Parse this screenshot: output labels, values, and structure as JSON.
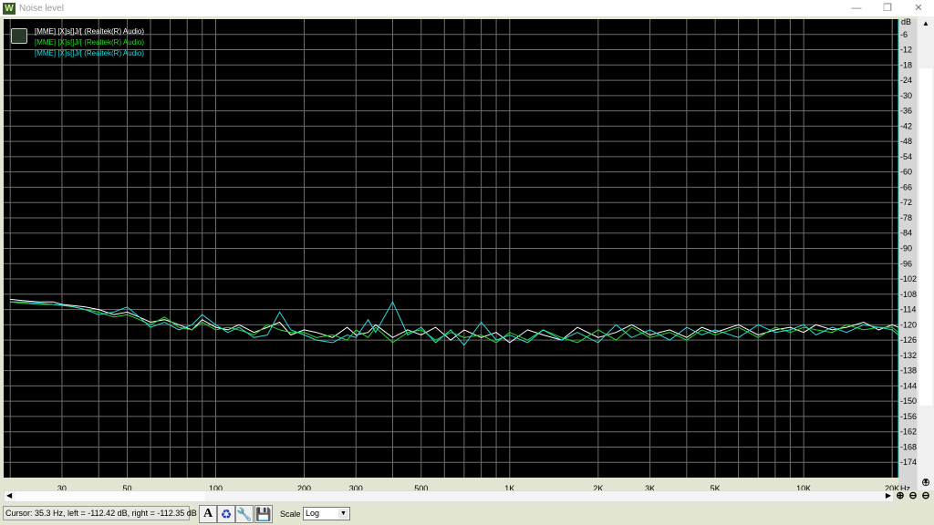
{
  "window": {
    "title": "Noise level",
    "minimize": "—",
    "restore": "❐",
    "close": "✕"
  },
  "legend": {
    "entries": [
      {
        "label": "[MME] [X]s[]J/[ (Realtek(R) Audio)",
        "color": "#ffffff"
      },
      {
        "label": "[MME] [X]s[]J/[ (Realtek(R) Audio)",
        "color": "#22dd22"
      },
      {
        "label": "[MME] [X]s[]J/[ (Realtek(R) Audio)",
        "color": "#22dddd"
      }
    ]
  },
  "status": {
    "cursor_text": "Cursor:  35.3 Hz,  left = -112.42 dB,  right = -112.35 dB"
  },
  "toolbar": {
    "scale_label": "Scale",
    "scale_value": "Log",
    "icons": [
      "font-icon",
      "refresh-icon",
      "wrench-icon",
      "save-icon"
    ]
  },
  "chart_data": {
    "type": "line",
    "title": "",
    "xlabel": "Hz",
    "ylabel": "dB",
    "x_scale": "log",
    "xlim": [
      19,
      21000
    ],
    "ylim": [
      -180,
      0
    ],
    "grid": true,
    "background": "#000000",
    "grid_color": "#6e6e6e",
    "legend_placement": "top-left",
    "x_ticks": [
      {
        "v": 30,
        "l": "30"
      },
      {
        "v": 50,
        "l": "50"
      },
      {
        "v": 100,
        "l": "100"
      },
      {
        "v": 200,
        "l": "200"
      },
      {
        "v": 300,
        "l": "300"
      },
      {
        "v": 500,
        "l": "500"
      },
      {
        "v": 1000,
        "l": "1K"
      },
      {
        "v": 2000,
        "l": "2K"
      },
      {
        "v": 3000,
        "l": "3K"
      },
      {
        "v": 5000,
        "l": "5K"
      },
      {
        "v": 10000,
        "l": "10K"
      },
      {
        "v": 20000,
        "l": "20K"
      }
    ],
    "y_ticks": [
      -6,
      -12,
      -18,
      -24,
      -30,
      -36,
      -42,
      -48,
      -54,
      -60,
      -66,
      -72,
      -78,
      -84,
      -90,
      -96,
      -102,
      -108,
      -114,
      -120,
      -126,
      -132,
      -138,
      -144,
      -150,
      -156,
      -162,
      -168,
      -174
    ],
    "x": [
      20,
      22,
      25,
      28,
      30,
      33,
      36,
      40,
      45,
      50,
      55,
      60,
      67,
      75,
      83,
      90,
      100,
      110,
      120,
      135,
      150,
      165,
      180,
      200,
      220,
      250,
      280,
      300,
      330,
      350,
      400,
      450,
      500,
      560,
      630,
      700,
      800,
      900,
      1000,
      1150,
      1300,
      1500,
      1700,
      2000,
      2300,
      2600,
      3000,
      3500,
      4000,
      4500,
      5000,
      6000,
      7000,
      8000,
      9000,
      10000,
      11000,
      12500,
      14000,
      16000,
      18000,
      20000,
      21000
    ],
    "series": [
      {
        "color": "#ffffff",
        "values": [
          -110,
          -110.5,
          -111,
          -111,
          -112,
          -112.5,
          -113,
          -114,
          -116,
          -115,
          -117,
          -119,
          -118,
          -120,
          -122,
          -118,
          -121,
          -122,
          -120,
          -123,
          -121,
          -119,
          -124,
          -122,
          -123,
          -125,
          -121,
          -124,
          -123,
          -120,
          -125,
          -122,
          -124,
          -121,
          -126,
          -122,
          -125,
          -123,
          -127,
          -122,
          -124,
          -126,
          -121,
          -125,
          -123,
          -120,
          -124,
          -122,
          -125,
          -121,
          -123,
          -120,
          -124,
          -122,
          -121,
          -123,
          -120,
          -122,
          -121,
          -119,
          -122,
          -120,
          -121
        ]
      },
      {
        "color": "#22dd22",
        "values": [
          -111,
          -111.5,
          -112,
          -112,
          -112.4,
          -113,
          -114,
          -115,
          -117,
          -116,
          -118,
          -120,
          -117,
          -121,
          -122,
          -119,
          -122,
          -121,
          -122,
          -124,
          -120,
          -122,
          -123,
          -123,
          -125,
          -124,
          -126,
          -122,
          -125,
          -121,
          -127,
          -123,
          -122,
          -126,
          -123,
          -125,
          -124,
          -127,
          -123,
          -126,
          -122,
          -125,
          -127,
          -122,
          -126,
          -121,
          -125,
          -123,
          -126,
          -122,
          -124,
          -121,
          -125,
          -121,
          -123,
          -121,
          -122,
          -123,
          -120,
          -122,
          -121,
          -121,
          -123
        ]
      },
      {
        "color": "#22dddd",
        "values": [
          -111,
          -111,
          -111.5,
          -112,
          -112.3,
          -113,
          -114,
          -116,
          -115,
          -113,
          -117,
          -121,
          -119,
          -122,
          -120,
          -116,
          -120,
          -123,
          -121,
          -125,
          -124,
          -115,
          -122,
          -124,
          -126,
          -127,
          -124,
          -125,
          -118,
          -123,
          -111,
          -124,
          -121,
          -127,
          -122,
          -128,
          -119,
          -126,
          -124,
          -127,
          -122,
          -126,
          -123,
          -127,
          -120,
          -125,
          -122,
          -126,
          -121,
          -124,
          -122,
          -125,
          -120,
          -123,
          -122,
          -120,
          -124,
          -121,
          -123,
          -120,
          -121,
          -122,
          -124
        ]
      }
    ]
  }
}
